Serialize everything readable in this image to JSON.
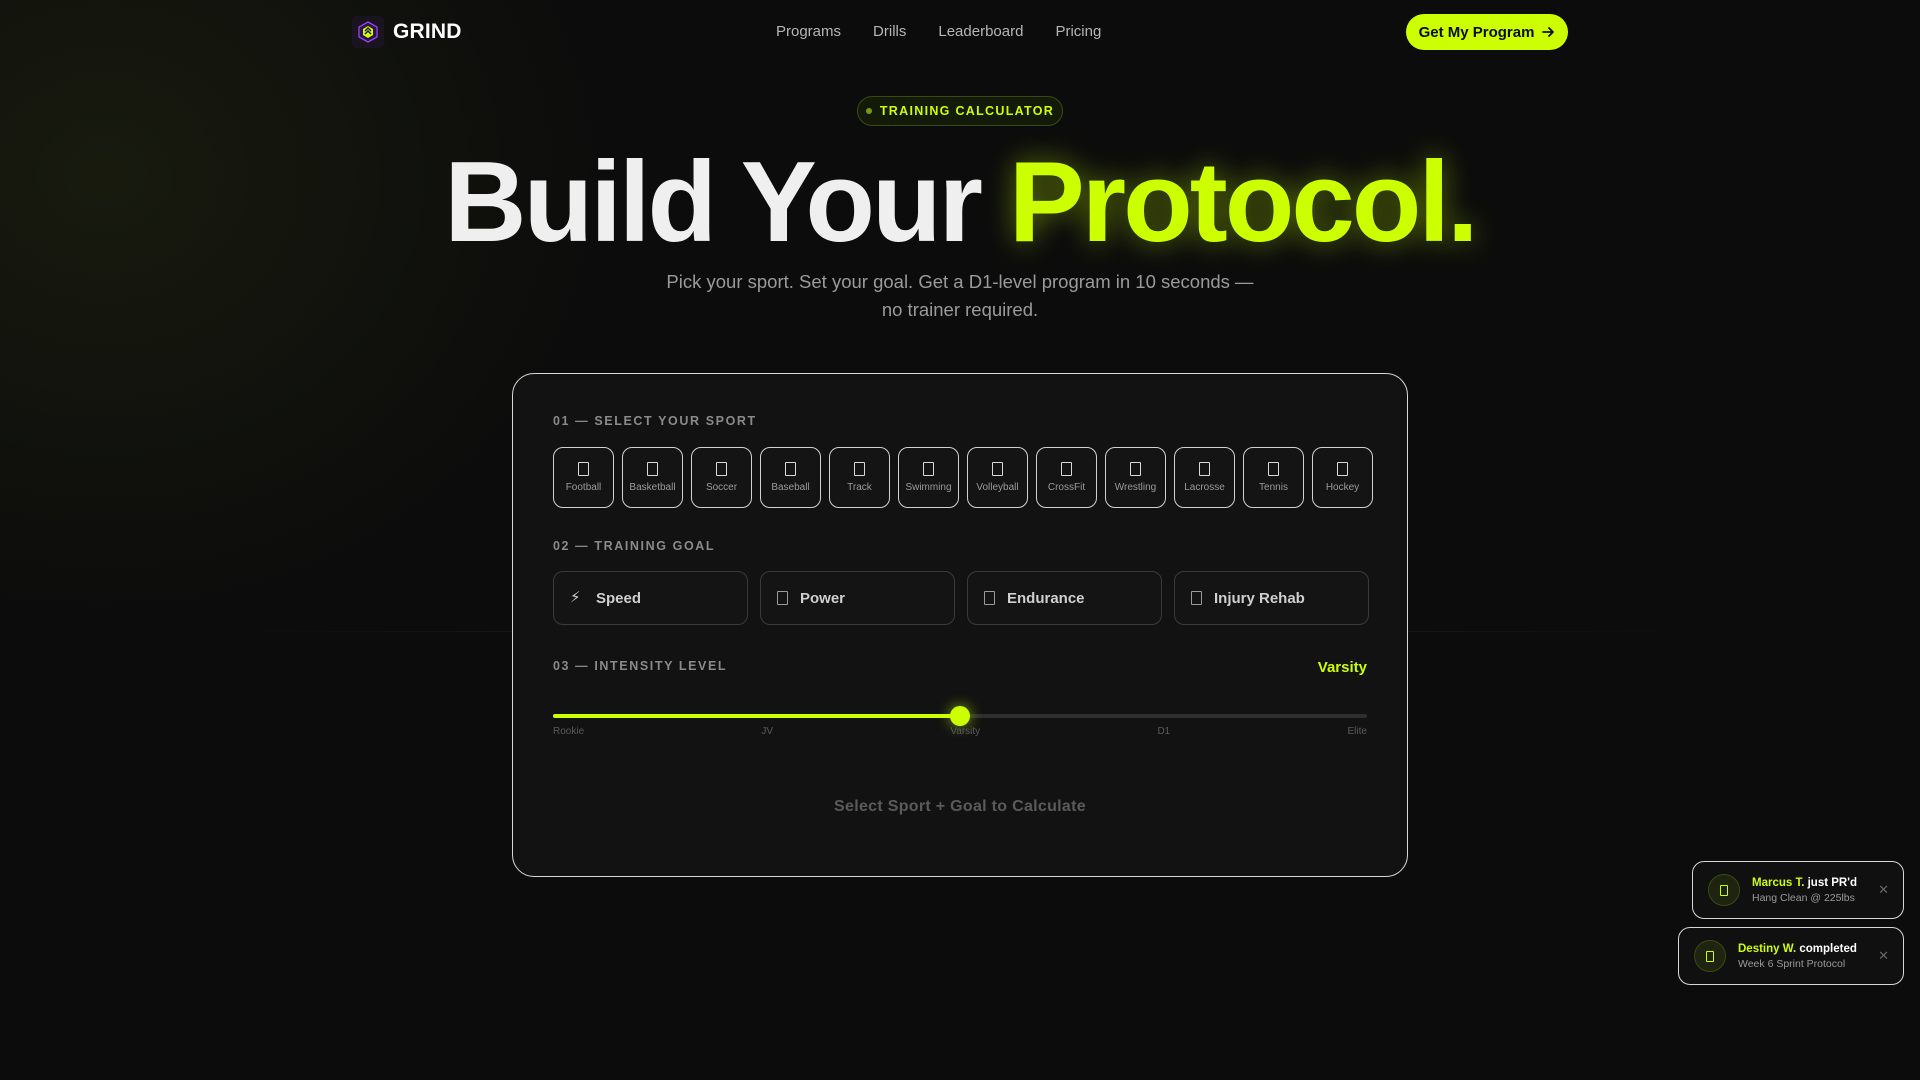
{
  "colors": {
    "accent": "#ccff00",
    "background": "#0c0c0c",
    "card": "#121212"
  },
  "nav": {
    "brand": "GRIND",
    "links": [
      "Programs",
      "Drills",
      "Leaderboard",
      "Pricing"
    ],
    "cta_label": "Get My Program"
  },
  "hero": {
    "badge": "TRAINING CALCULATOR",
    "title_plain": "Build Your ",
    "title_accent": "Protocol.",
    "subtitle": "Pick your sport. Set your goal. Get a D1-level program in 10 seconds — no trainer required."
  },
  "calculator": {
    "sport_label": "01 — SELECT YOUR SPORT",
    "sports": [
      "Football",
      "Basketball",
      "Soccer",
      "Baseball",
      "Track",
      "Swimming",
      "Volleyball",
      "CrossFit",
      "Wrestling",
      "Lacrosse",
      "Tennis",
      "Hockey"
    ],
    "goal_label": "02 — TRAINING GOAL",
    "goals": [
      {
        "label": "Speed",
        "icon": "bolt-icon"
      },
      {
        "label": "Power",
        "icon": "power-icon"
      },
      {
        "label": "Endurance",
        "icon": "endurance-icon"
      },
      {
        "label": "Injury Rehab",
        "icon": "rehab-icon"
      }
    ],
    "intensity_label": "03 — INTENSITY LEVEL",
    "intensity_value": "Varsity",
    "intensity_fraction": 0.5,
    "intensity_ticks": [
      "Rookie",
      "JV",
      "Varsity",
      "D1",
      "Elite"
    ],
    "calculate_label": "Select Sport + Goal to Calculate"
  },
  "toasts": [
    {
      "name": "Marcus T.",
      "action": " just PR'd",
      "detail": "Hang Clean @ 225lbs"
    },
    {
      "name": "Destiny W.",
      "action": " completed",
      "detail": "Week 6 Sprint Protocol"
    }
  ]
}
